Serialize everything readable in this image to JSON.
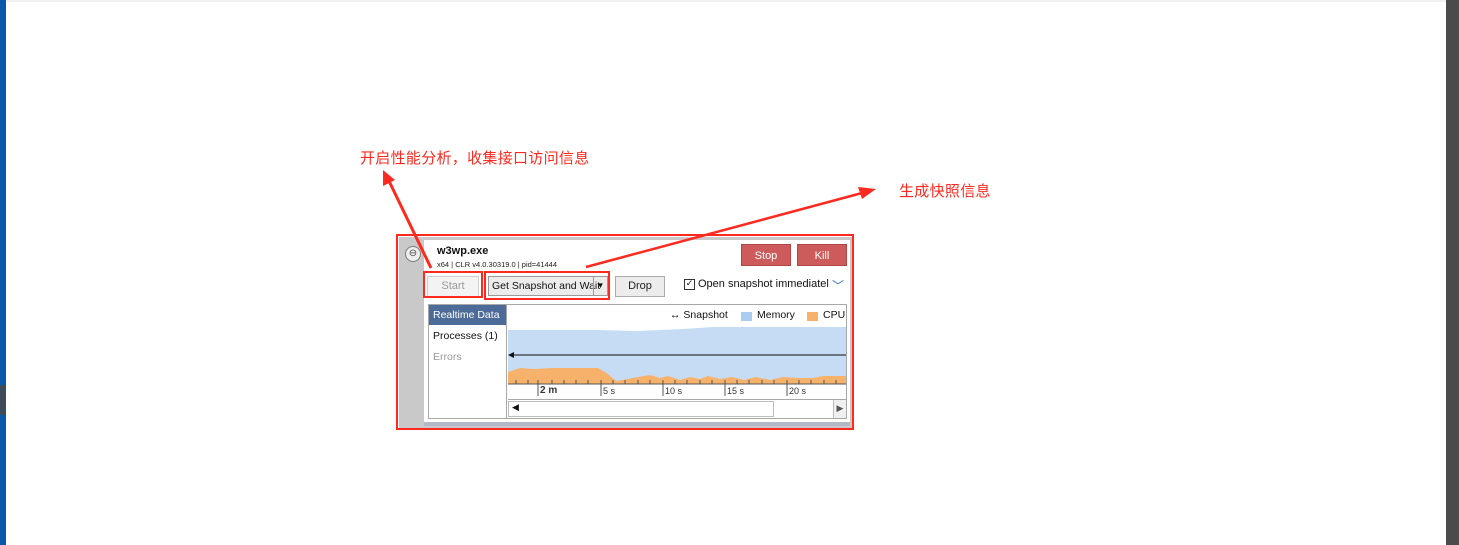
{
  "annotations": {
    "start_note": "开启性能分析，收集接口访问信息",
    "snapshot_note": "生成快照信息"
  },
  "process": {
    "name": "w3wp.exe",
    "info": "x64 | CLR v4.0.30319.0 | pid=41444"
  },
  "buttons": {
    "stop": "Stop",
    "kill": "Kill",
    "start": "Start",
    "snapshot_combo": "Get Snapshot and Wait",
    "drop": "Drop"
  },
  "options": {
    "open_snapshot_label": "Open snapshot immediatel",
    "open_snapshot_checked": true
  },
  "sidebar": {
    "items": [
      {
        "label": "Realtime Data",
        "state": "active"
      },
      {
        "label": "Processes (1)",
        "state": "normal"
      },
      {
        "label": "Errors",
        "state": "disabled"
      }
    ]
  },
  "legend": {
    "snapshot": "Snapshot",
    "memory": "Memory",
    "cpu": "CPU"
  },
  "timeline": {
    "ticks": [
      "2 m",
      "5 s",
      "10 s",
      "15 s",
      "20 s"
    ]
  },
  "colors": {
    "annotation_red": "#ff2a1f",
    "memory_fill": "#c6dcf5",
    "cpu_fill": "#f6b26b",
    "stop_red": "#cd5b5b",
    "active_tab": "#4d6b99"
  }
}
